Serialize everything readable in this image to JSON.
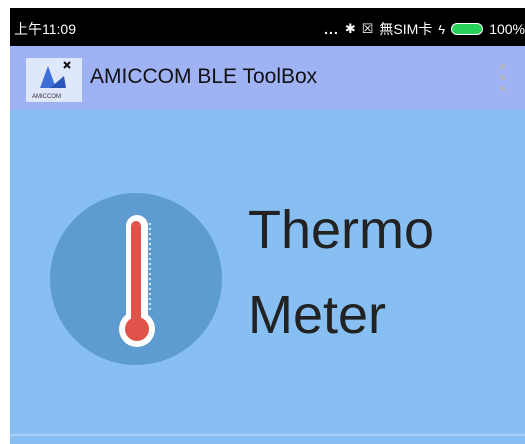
{
  "statusbar": {
    "time": "上午11:09",
    "signal_dots": "...",
    "sim_text": "無SIM卡",
    "battery_percent": "100%",
    "icons": [
      "bluetooth-icon",
      "sim-x-icon",
      "charging-bolt-icon",
      "battery-icon"
    ]
  },
  "appbar": {
    "title": "AMICCOM BLE ToolBox",
    "logo_text": "AMICCOM",
    "icons": [
      "amiccom-logo-icon",
      "overflow-menu-icon"
    ]
  },
  "feature": {
    "line1": "Thermo",
    "line2": "Meter",
    "icon": "thermometer-icon"
  },
  "colors": {
    "statusbar_bg": "#000000",
    "appbar_bg": "#9fb2f4",
    "content_bg": "#87bff2",
    "circle": "#5d9bd0",
    "mercury": "#e0524a"
  }
}
